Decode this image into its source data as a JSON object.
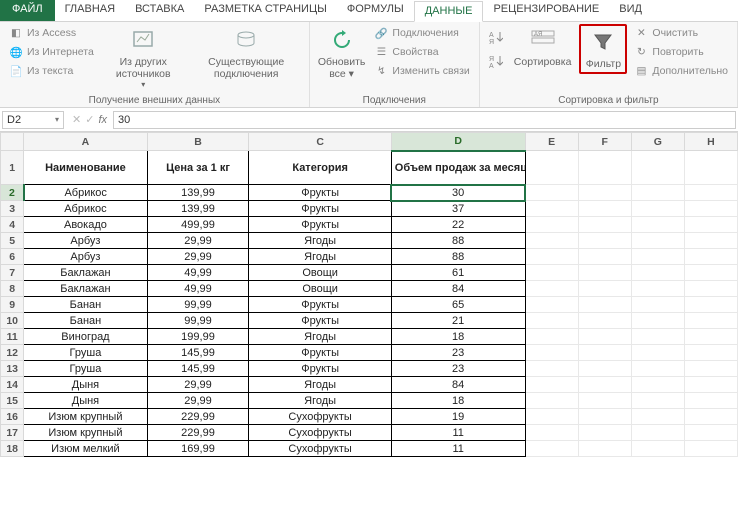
{
  "tabs": {
    "file": "ФАЙЛ",
    "home": "ГЛАВНАЯ",
    "insert": "ВСТАВКА",
    "page_layout": "РАЗМЕТКА СТРАНИЦЫ",
    "formulas": "ФОРМУЛЫ",
    "data": "ДАННЫЕ",
    "review": "РЕЦЕНЗИРОВАНИЕ",
    "view": "ВИД"
  },
  "ribbon": {
    "get_external": {
      "access": "Из Access",
      "web": "Из Интернета",
      "text": "Из текста",
      "other_sources": "Из других источников",
      "existing": "Существующие подключения",
      "group_label": "Получение внешних данных"
    },
    "connections": {
      "refresh_all": "Обновить все ▾",
      "connections": "Подключения",
      "properties": "Свойства",
      "edit_links": "Изменить связи",
      "group_label": "Подключения"
    },
    "sort_filter": {
      "sort_az_icon": "A↓Я",
      "sort_za_icon": "Я↓А",
      "sort": "Сортировка",
      "filter": "Фильтр",
      "clear": "Очистить",
      "reapply": "Повторить",
      "advanced": "Дополнительно",
      "group_label": "Сортировка и фильтр"
    }
  },
  "formula_bar": {
    "name_box": "D2",
    "fx": "fx",
    "formula": "30"
  },
  "columns": [
    "A",
    "B",
    "C",
    "D",
    "E",
    "F",
    "G",
    "H"
  ],
  "header_row": {
    "A": "Наименование",
    "B": "Цена за 1 кг",
    "C": "Категория",
    "D": "Объем продаж за месяц (кг)"
  },
  "data_rows": [
    {
      "r": 2,
      "A": "Абрикос",
      "B": "139,99",
      "C": "Фрукты",
      "D": "30"
    },
    {
      "r": 3,
      "A": "Абрикос",
      "B": "139,99",
      "C": "Фрукты",
      "D": "37"
    },
    {
      "r": 4,
      "A": "Авокадо",
      "B": "499,99",
      "C": "Фрукты",
      "D": "22"
    },
    {
      "r": 5,
      "A": "Арбуз",
      "B": "29,99",
      "C": "Ягоды",
      "D": "88"
    },
    {
      "r": 6,
      "A": "Арбуз",
      "B": "29,99",
      "C": "Ягоды",
      "D": "88"
    },
    {
      "r": 7,
      "A": "Баклажан",
      "B": "49,99",
      "C": "Овощи",
      "D": "61"
    },
    {
      "r": 8,
      "A": "Баклажан",
      "B": "49,99",
      "C": "Овощи",
      "D": "84"
    },
    {
      "r": 9,
      "A": "Банан",
      "B": "99,99",
      "C": "Фрукты",
      "D": "65"
    },
    {
      "r": 10,
      "A": "Банан",
      "B": "99,99",
      "C": "Фрукты",
      "D": "21"
    },
    {
      "r": 11,
      "A": "Виноград",
      "B": "199,99",
      "C": "Ягоды",
      "D": "18"
    },
    {
      "r": 12,
      "A": "Груша",
      "B": "145,99",
      "C": "Фрукты",
      "D": "23"
    },
    {
      "r": 13,
      "A": "Груша",
      "B": "145,99",
      "C": "Фрукты",
      "D": "23"
    },
    {
      "r": 14,
      "A": "Дыня",
      "B": "29,99",
      "C": "Ягоды",
      "D": "84"
    },
    {
      "r": 15,
      "A": "Дыня",
      "B": "29,99",
      "C": "Ягоды",
      "D": "18"
    },
    {
      "r": 16,
      "A": "Изюм крупный",
      "B": "229,99",
      "C": "Сухофрукты",
      "D": "19"
    },
    {
      "r": 17,
      "A": "Изюм крупный",
      "B": "229,99",
      "C": "Сухофрукты",
      "D": "11"
    },
    {
      "r": 18,
      "A": "Изюм мелкий",
      "B": "169,99",
      "C": "Сухофрукты",
      "D": "11"
    }
  ],
  "active_cell": {
    "row": 2,
    "col": "D"
  }
}
